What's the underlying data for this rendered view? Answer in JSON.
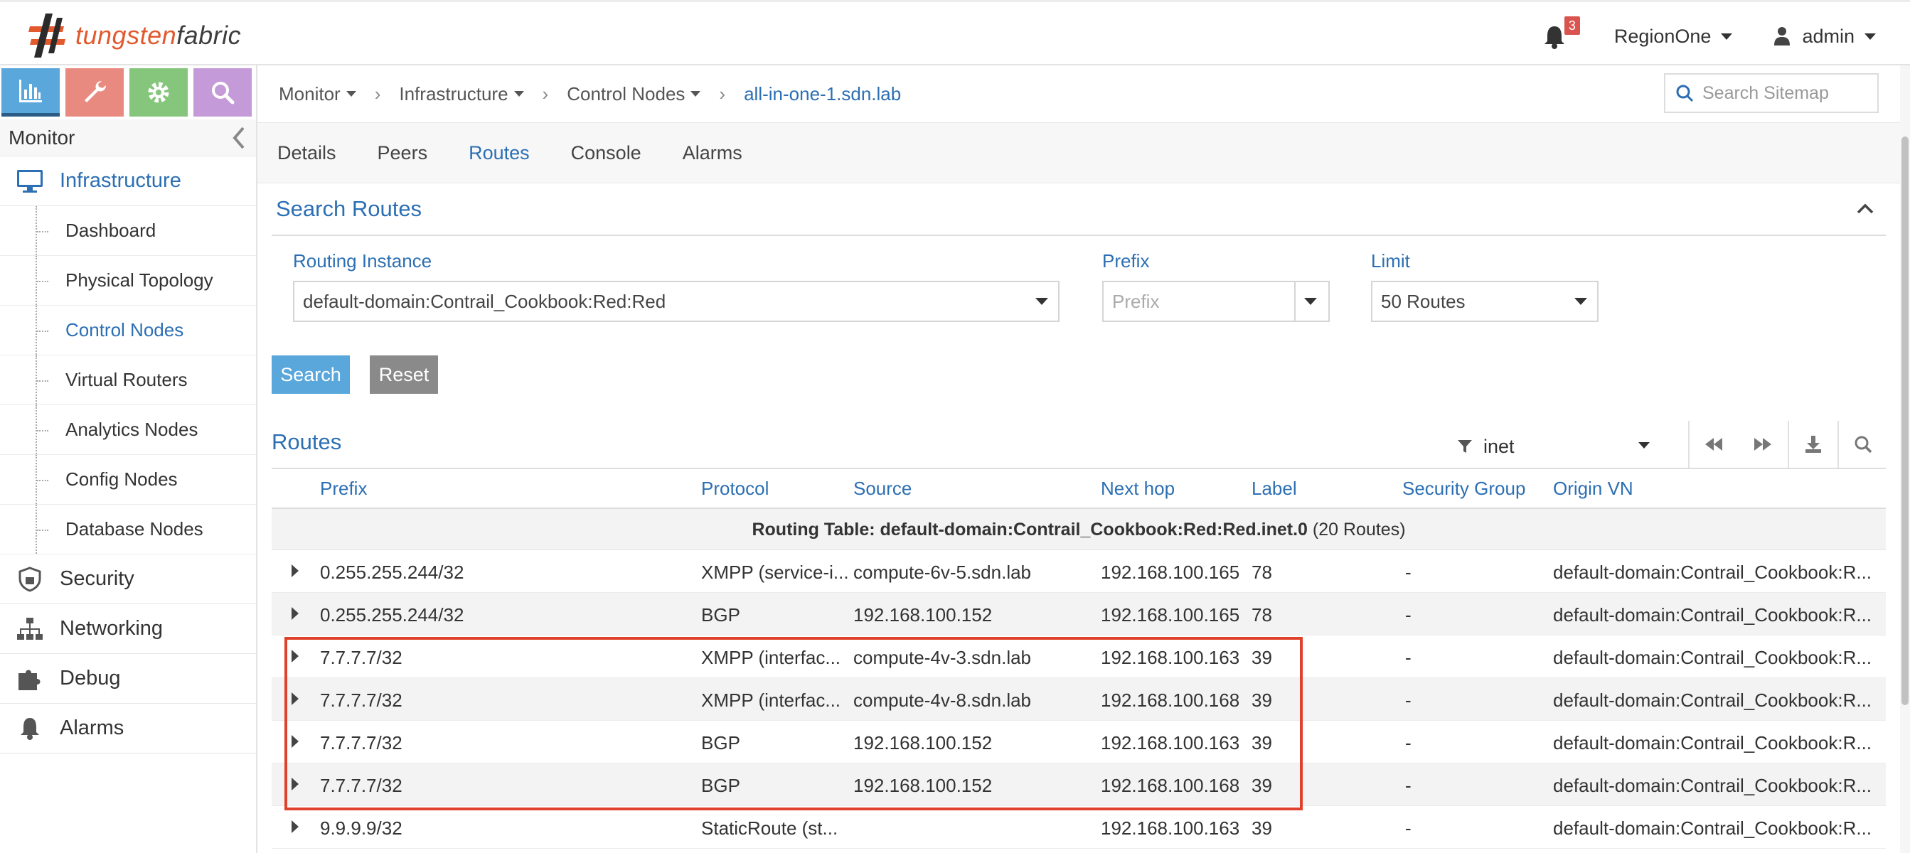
{
  "brand": {
    "part1": "tungsten",
    "part2": "fabric",
    "primary": "#2c6fb3",
    "accent": "#e2592e"
  },
  "header": {
    "notifications_icon": "bell-icon",
    "alarm_count": "3",
    "region": "RegionOne",
    "user_icon": "user-icon",
    "user": "admin"
  },
  "sidebar": {
    "modules": [
      {
        "name": "monitor",
        "icon": "bar-chart-icon",
        "color": "#5aa7dc"
      },
      {
        "name": "configure",
        "icon": "wrench-icon",
        "color": "#e98a80"
      },
      {
        "name": "settings",
        "icon": "gear-icon",
        "color": "#86c57c"
      },
      {
        "name": "query",
        "icon": "search-icon",
        "color": "#c49ad8"
      }
    ],
    "title": "Monitor",
    "main_items": {
      "infrastructure": "Infrastructure",
      "security": "Security",
      "networking": "Networking",
      "debug": "Debug",
      "alarms": "Alarms"
    },
    "sub_items": [
      "Dashboard",
      "Physical Topology",
      "Control Nodes",
      "Virtual Routers",
      "Analytics Nodes",
      "Config Nodes",
      "Database Nodes"
    ],
    "active_sub": "Control Nodes"
  },
  "breadcrumb": {
    "items": [
      "Monitor",
      "Infrastructure",
      "Control Nodes"
    ],
    "current": "all-in-one-1.sdn.lab",
    "search_placeholder": "Search Sitemap"
  },
  "tabs": [
    "Details",
    "Peers",
    "Routes",
    "Console",
    "Alarms"
  ],
  "active_tab": "Routes",
  "search_panel": {
    "title": "Search Routes",
    "routing_instance_label": "Routing Instance",
    "routing_instance_value": "default-domain:Contrail_Cookbook:Red:Red",
    "prefix_label": "Prefix",
    "prefix_placeholder": "Prefix",
    "limit_label": "Limit",
    "limit_value": "50 Routes",
    "search_button": "Search",
    "reset_button": "Reset"
  },
  "routes_grid": {
    "title": "Routes",
    "filter_value": "inet",
    "columns": {
      "prefix": "Prefix",
      "protocol": "Protocol",
      "source": "Source",
      "next_hop": "Next hop",
      "label": "Label",
      "security_group": "Security Group",
      "origin_vn": "Origin VN"
    },
    "group": {
      "label": "Routing Table: default-domain:Contrail_Cookbook:Red:Red.inet.0",
      "count": "(20 Routes)"
    },
    "rows": [
      {
        "prefix": "0.255.255.244/32",
        "protocol": "XMPP (service-i...",
        "source": "compute-6v-5.sdn.lab",
        "next_hop": "192.168.100.165",
        "label": "78",
        "security_group": "-",
        "origin_vn": "default-domain:Contrail_Cookbook:R..."
      },
      {
        "prefix": "0.255.255.244/32",
        "protocol": "BGP",
        "source": "192.168.100.152",
        "next_hop": "192.168.100.165",
        "label": "78",
        "security_group": "-",
        "origin_vn": "default-domain:Contrail_Cookbook:R..."
      },
      {
        "prefix": "7.7.7.7/32",
        "protocol": "XMPP (interfac...",
        "source": "compute-4v-3.sdn.lab",
        "next_hop": "192.168.100.163",
        "label": "39",
        "security_group": "-",
        "origin_vn": "default-domain:Contrail_Cookbook:R..."
      },
      {
        "prefix": "7.7.7.7/32",
        "protocol": "XMPP (interfac...",
        "source": "compute-4v-8.sdn.lab",
        "next_hop": "192.168.100.168",
        "label": "39",
        "security_group": "-",
        "origin_vn": "default-domain:Contrail_Cookbook:R..."
      },
      {
        "prefix": "7.7.7.7/32",
        "protocol": "BGP",
        "source": "192.168.100.152",
        "next_hop": "192.168.100.163",
        "label": "39",
        "security_group": "-",
        "origin_vn": "default-domain:Contrail_Cookbook:R..."
      },
      {
        "prefix": "7.7.7.7/32",
        "protocol": "BGP",
        "source": "192.168.100.152",
        "next_hop": "192.168.100.168",
        "label": "39",
        "security_group": "-",
        "origin_vn": "default-domain:Contrail_Cookbook:R..."
      },
      {
        "prefix": "9.9.9.9/32",
        "protocol": "StaticRoute (st...",
        "source": "",
        "next_hop": "192.168.100.163",
        "label": "39",
        "security_group": "-",
        "origin_vn": "default-domain:Contrail_Cookbook:R..."
      }
    ],
    "highlight_color": "#e0412c"
  }
}
